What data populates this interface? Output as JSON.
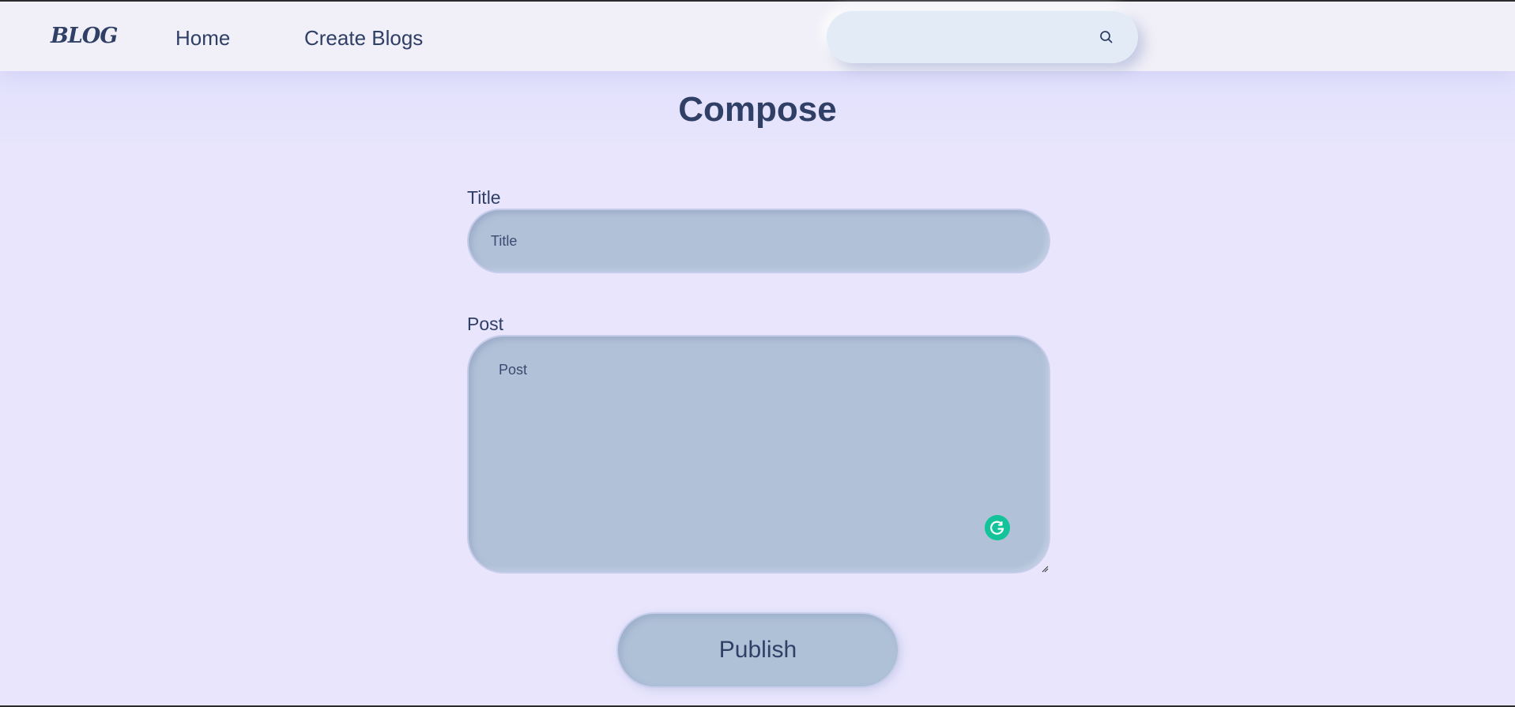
{
  "header": {
    "logo": "BLOG",
    "nav": {
      "home": "Home",
      "create": "Create Blogs"
    },
    "search": {
      "value": "",
      "icon": "search-icon"
    }
  },
  "page": {
    "title": "Compose"
  },
  "form": {
    "title_label": "Title",
    "title_placeholder": "Title",
    "post_label": "Post",
    "post_placeholder": "Post",
    "publish_label": "Publish"
  },
  "colors": {
    "background": "#e8e5fd",
    "navbar": "#f1f0f8",
    "text": "#2f3f66",
    "input_fill": "#b1c2d8",
    "grammarly": "#15c39a"
  }
}
